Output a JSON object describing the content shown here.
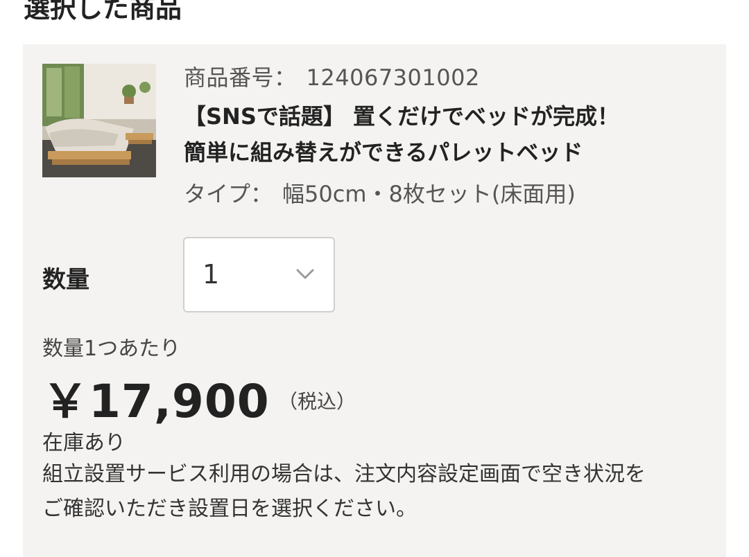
{
  "section": {
    "title": "選択した商品"
  },
  "product": {
    "image_alt": "product-photo",
    "number_label": "商品番号：",
    "number_value": "124067301002",
    "name_line1": "【SNSで話題】 置くだけでベッドが完成！",
    "name_line2": "簡単に組み替えができるパレットベッド",
    "type_label": "タイプ：",
    "type_value": "幅50cm・8枚セット(床面用)"
  },
  "quantity": {
    "label": "数量",
    "selected": "1",
    "icon": "chevron-down-icon"
  },
  "pricing": {
    "unit_caption": "数量1つあたり",
    "price": "￥17,900",
    "tax_note": "（税込）"
  },
  "stock": {
    "status": "在庫あり"
  },
  "notice": {
    "line1": "組立設置サービス利用の場合は、注文内容設定画面で空き状況を",
    "line2": "ご確認いただき設置日を選択ください。"
  },
  "colors": {
    "panel_bg": "#f4f3f1",
    "text_primary": "#222222",
    "text_secondary": "#555555",
    "select_border": "#cfcfcf"
  }
}
